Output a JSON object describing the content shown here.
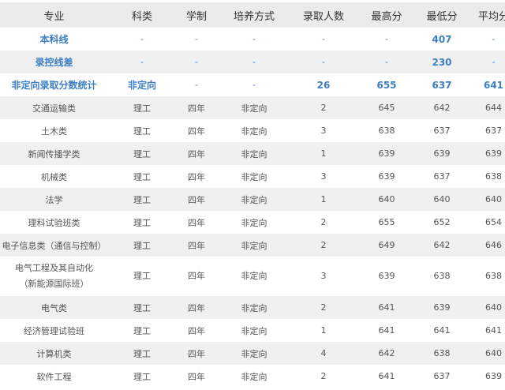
{
  "headers": [
    "专业",
    "科类",
    "学制",
    "培养方式",
    "录取人数",
    "最高分",
    "最低分",
    "平均分"
  ],
  "summary_rows": [
    [
      "本科线",
      "-",
      "-",
      "-",
      "-",
      "-",
      "407",
      "-"
    ],
    [
      "录控线差",
      "-",
      "-",
      "-",
      "-",
      "-",
      "230",
      "-"
    ],
    [
      "非定向录取分数统计",
      "非定向",
      "-",
      "-",
      "26",
      "655",
      "637",
      "641"
    ]
  ],
  "rows": [
    [
      "交通运输类",
      "理工",
      "四年",
      "非定向",
      "2",
      "645",
      "642",
      "644"
    ],
    [
      "土木类",
      "理工",
      "四年",
      "非定向",
      "3",
      "638",
      "637",
      "637"
    ],
    [
      "新闻传播学类",
      "理工",
      "四年",
      "非定向",
      "1",
      "639",
      "639",
      "639"
    ],
    [
      "机械类",
      "理工",
      "四年",
      "非定向",
      "3",
      "639",
      "637",
      "638"
    ],
    [
      "法学",
      "理工",
      "四年",
      "非定向",
      "1",
      "640",
      "640",
      "640"
    ],
    [
      "理科试验班类",
      "理工",
      "四年",
      "非定向",
      "2",
      "655",
      "652",
      "654"
    ],
    [
      "电子信息类（通信与控制）",
      "理工",
      "四年",
      "非定向",
      "2",
      "649",
      "642",
      "646"
    ],
    [
      "电气工程及其自动化\n（新能源国际班）",
      "理工",
      "四年",
      "非定向",
      "3",
      "639",
      "638",
      "638"
    ],
    [
      "电气类",
      "理工",
      "四年",
      "非定向",
      "2",
      "641",
      "639",
      "640"
    ],
    [
      "经济管理试验班",
      "理工",
      "四年",
      "非定向",
      "1",
      "641",
      "641",
      "641"
    ],
    [
      "计算机类",
      "理工",
      "四年",
      "非定向",
      "4",
      "642",
      "638",
      "640"
    ],
    [
      "软件工程",
      "理工",
      "四年",
      "非定向",
      "2",
      "641",
      "637",
      "639"
    ]
  ]
}
